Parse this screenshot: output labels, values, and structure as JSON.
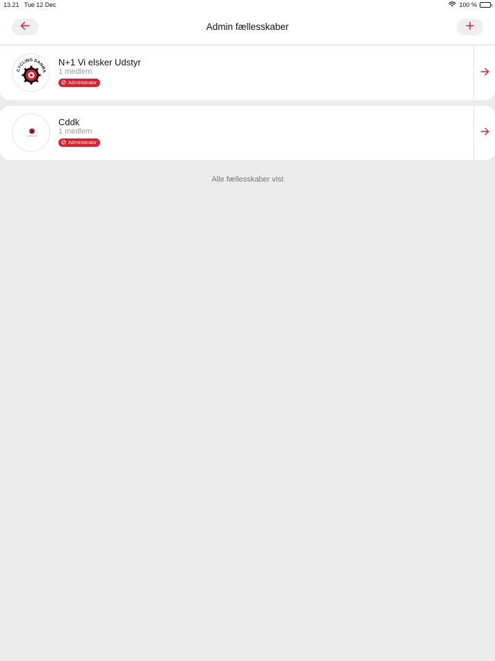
{
  "status": {
    "time": "13.21",
    "date": "Tue 12 Dec",
    "battery": "100 %"
  },
  "header": {
    "title": "Admin fællesskaber"
  },
  "communities": [
    {
      "name": "N+1 Vi elsker Udstyr",
      "members": "1 medlem",
      "role": "Administrator",
      "logo_text": "CYCLING DANMARK.CC"
    },
    {
      "name": "Cddk",
      "members": "1 medlem",
      "role": "Administrator"
    }
  ],
  "footer": {
    "note": "Alle fællesskaber vist"
  },
  "colors": {
    "accent": "#e01e2b",
    "background": "#ececec"
  }
}
